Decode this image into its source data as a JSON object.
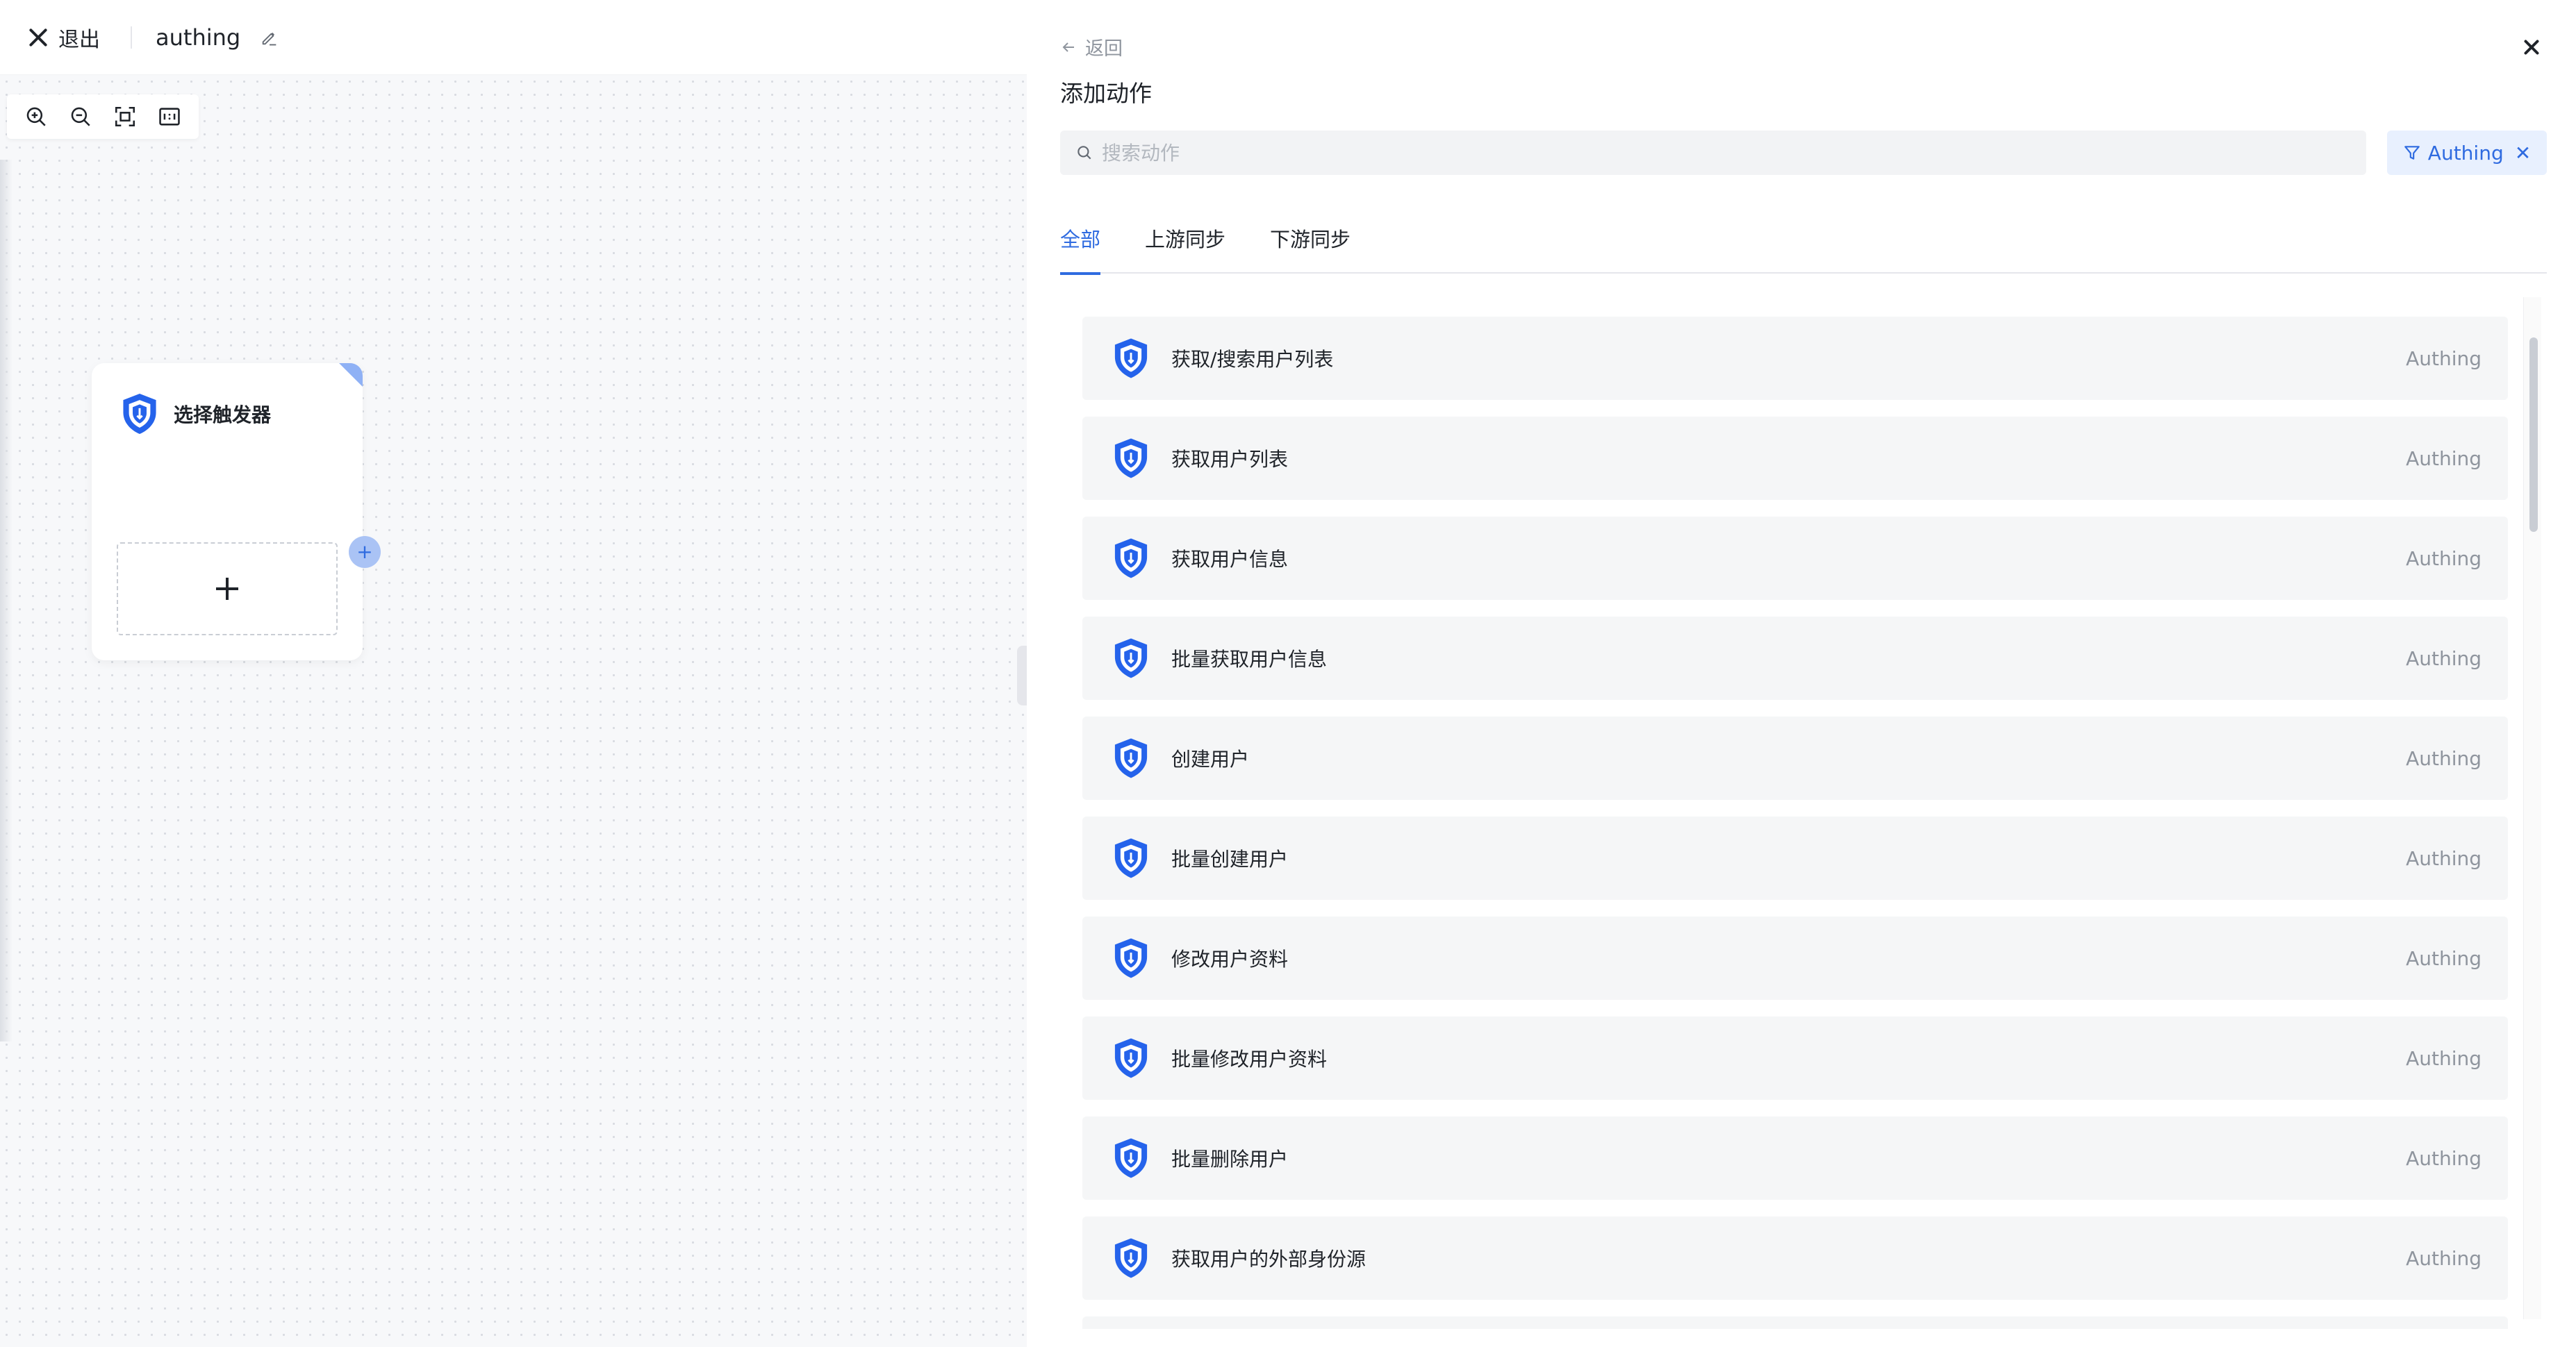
{
  "topbar": {
    "exit_label": "退出",
    "flow_title": "authing"
  },
  "icons": {
    "exit": "close-x-icon",
    "edit": "pencil-icon",
    "zoom_in": "zoom-in-icon",
    "zoom_out": "zoom-out-icon",
    "fit": "fit-screen-icon",
    "actual_size": "actual-size-1-1-icon",
    "app": "authing-shield-icon"
  },
  "canvas": {
    "node": {
      "title": "选择触发器"
    }
  },
  "panel": {
    "back_label": "返回",
    "title": "添加动作",
    "search_placeholder": "搜索动作",
    "filter_tag": "Authing",
    "tabs": [
      "全部",
      "上游同步",
      "下游同步"
    ],
    "actions": [
      {
        "name": "获取/搜索用户列表",
        "tag": "Authing"
      },
      {
        "name": "获取用户列表",
        "tag": "Authing"
      },
      {
        "name": "获取用户信息",
        "tag": "Authing"
      },
      {
        "name": "批量获取用户信息",
        "tag": "Authing"
      },
      {
        "name": "创建用户",
        "tag": "Authing"
      },
      {
        "name": "批量创建用户",
        "tag": "Authing"
      },
      {
        "name": "修改用户资料",
        "tag": "Authing"
      },
      {
        "name": "批量修改用户资料",
        "tag": "Authing"
      },
      {
        "name": "批量删除用户",
        "tag": "Authing"
      },
      {
        "name": "获取用户的外部身份源",
        "tag": "Authing"
      }
    ]
  },
  "colors": {
    "accent": "#2f6be0",
    "shield": "#2563eb",
    "row_bg": "#f5f6f7",
    "canvas_bg": "#f7f8fa"
  }
}
